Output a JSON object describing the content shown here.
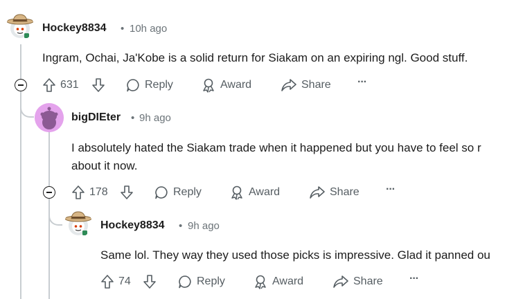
{
  "comments": [
    {
      "author": "Hockey8834",
      "time": "10h ago",
      "text_lines": [
        "Ingram, Ochai, Ja'Kobe is a solid return for Siakam on an expiring ngl. Good stuff."
      ],
      "score": "631",
      "reply_label": "Reply",
      "award_label": "Award",
      "share_label": "Share",
      "more_label": "···"
    },
    {
      "author": "bigDIEter",
      "time": "9h ago",
      "text_lines": [
        "I absolutely hated the Siakam trade when it happened but you have to feel so r",
        "about it now."
      ],
      "score": "178",
      "reply_label": "Reply",
      "award_label": "Award",
      "share_label": "Share",
      "more_label": "···"
    },
    {
      "author": "Hockey8834",
      "time": "9h ago",
      "text_lines": [
        "Same lol. They way they used those picks is impressive. Glad it panned ou"
      ],
      "score": "74",
      "reply_label": "Reply",
      "award_label": "Award",
      "share_label": "Share",
      "more_label": "···"
    }
  ],
  "meta_separator": "•"
}
